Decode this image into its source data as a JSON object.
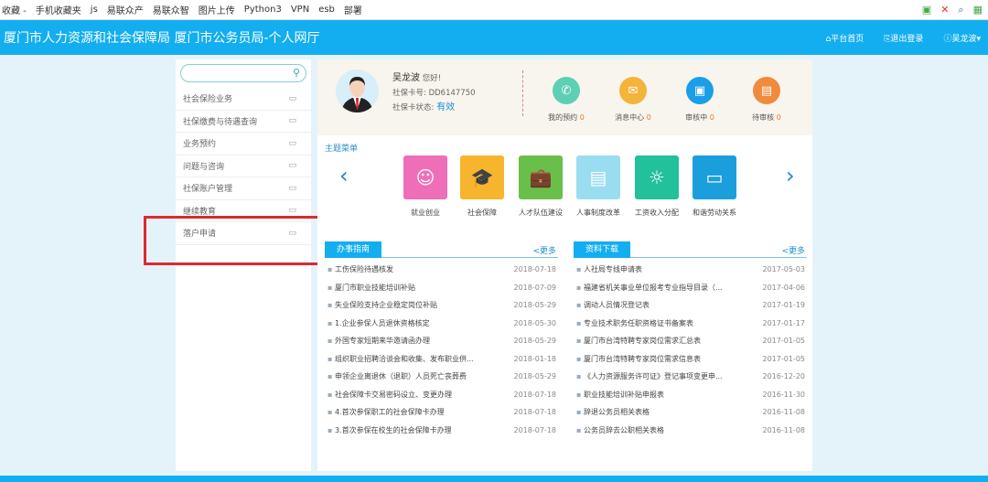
{
  "bookmarks": [
    "收藏 -",
    "手机收藏夹",
    "js",
    "易联众产",
    "易联众智",
    "图片上传",
    "Python3",
    "VPN",
    "esb",
    "部署"
  ],
  "header": {
    "title": "厦门市人力资源和社会保障局 厦门市公务员局-个人网厅",
    "nav": [
      "平台首页",
      "退出登录",
      "吴龙波"
    ]
  },
  "sidebar": {
    "search_placeholder": "",
    "items": [
      "社会保险业务",
      "社保缴费与待遇查询",
      "业务预约",
      "问题与咨询",
      "社保账户管理",
      "继续教育",
      "落户申请"
    ]
  },
  "profile": {
    "name": "吴龙波",
    "greeting": "您好!",
    "card_label": "社保卡号:",
    "card_no": "DD6147750",
    "status_label": "社保卡状态:",
    "status": "有效"
  },
  "stats": [
    {
      "label": "我的预约",
      "count": "0",
      "color": "#5dcfb5",
      "icon": "phone-icon"
    },
    {
      "label": "消息中心",
      "count": "0",
      "color": "#f3b43a",
      "icon": "mail-icon"
    },
    {
      "label": "审核中",
      "count": "0",
      "color": "#1a9ee8",
      "icon": "calendar-icon"
    },
    {
      "label": "待审核",
      "count": "0",
      "color": "#f08a3c",
      "icon": "clipboard-icon"
    }
  ],
  "menu": {
    "title": "主题菜单",
    "tiles": [
      {
        "label": "就业创业",
        "color": "#ee6fb8",
        "icon": "baby-face-icon"
      },
      {
        "label": "社会保障",
        "color": "#f7b52d",
        "icon": "graduation-cap-icon"
      },
      {
        "label": "人才队伍建设",
        "color": "#6abf4b",
        "icon": "briefcase-icon"
      },
      {
        "label": "人事制度改革",
        "color": "#9adcf0",
        "icon": "id-card-icon"
      },
      {
        "label": "工资收入分配",
        "color": "#22c09b",
        "icon": "lightbulb-icon"
      },
      {
        "label": "和谐劳动关系",
        "color": "#1a9fdc",
        "icon": "card-icon"
      }
    ]
  },
  "guide": {
    "title": "办事指南",
    "more": "<更多",
    "rows": [
      [
        "工伤保险待遇核发",
        "2018-07-18"
      ],
      [
        "厦门市职业技能培训补贴",
        "2018-07-09"
      ],
      [
        "失业保险支持企业稳定岗位补贴",
        "2018-05-29"
      ],
      [
        "1.企业参保人员退休资格核定",
        "2018-05-30"
      ],
      [
        "外国专家短期来华邀请函办理",
        "2018-05-29"
      ],
      [
        "组织职业招聘洽谈会和收集、发布职业供...",
        "2018-01-18"
      ],
      [
        "申领企业离退休（退职）人员死亡丧葬费",
        "2018-05-29"
      ],
      [
        "社会保障卡交易密码设立、变更办理",
        "2018-07-18"
      ],
      [
        "4.首次参保职工的社会保障卡办理",
        "2018-07-18"
      ],
      [
        "3.首次参保在校生的社会保障卡办理",
        "2018-07-18"
      ]
    ]
  },
  "downloads": {
    "title": "资料下载",
    "more": "<更多",
    "rows": [
      [
        "人社局专线申请表",
        "2017-05-03"
      ],
      [
        "福建省机关事业单位报考专业指导目录（...",
        "2017-04-06"
      ],
      [
        "调动人员情况登记表",
        "2017-01-19"
      ],
      [
        "专业技术职务任职资格证书备案表",
        "2017-01-17"
      ],
      [
        "厦门市台湾特聘专家岗位需求汇总表",
        "2017-01-05"
      ],
      [
        "厦门市台湾特聘专家岗位需求信息表",
        "2017-01-05"
      ],
      [
        "《人力资源服务许可证》登记事项变更申...",
        "2016-12-20"
      ],
      [
        "职业技能培训补贴申报表",
        "2016-11-30"
      ],
      [
        "辞退公务员相关表格",
        "2016-11-08"
      ],
      [
        "公务员辞去公职相关表格",
        "2016-11-08"
      ]
    ]
  }
}
